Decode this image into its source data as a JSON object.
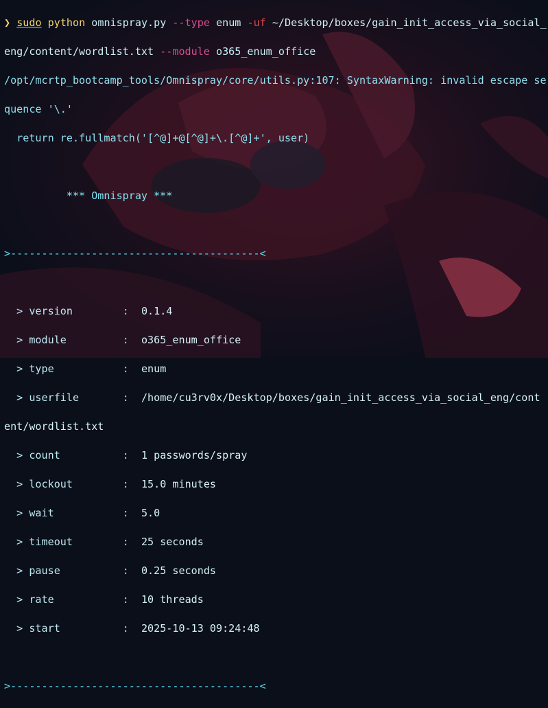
{
  "theme": {
    "background": "#0b0f1a",
    "accent": "#5cdaf3",
    "prompt": "#f5d46c",
    "flag": "#d84c8f"
  },
  "prompt": {
    "symbol": "❯",
    "sudo": "sudo",
    "python": "python",
    "script": "omnispray.py",
    "flag_type": "--type",
    "type_value": "enum",
    "flag_uf": "-uf",
    "uf_value_line1": "~/Desktop/boxes/gain_init_access_via_social_",
    "uf_value_line2": "eng/content/wordlist.txt",
    "flag_module": "--module",
    "module_value": "o365_enum_office"
  },
  "warning": {
    "line1": "/opt/mcrtp_bootcamp_tools/Omnispray/core/utils.py:107: SyntaxWarning: invalid escape se",
    "line2": "quence '\\.'",
    "line3": "  return re.fullmatch('[^@]+@[^@]+\\.[^@]+', user)"
  },
  "banner": "          *** Omnispray ***",
  "separator": ">----------------------------------------<",
  "config": [
    {
      "key": "  > version",
      "value": "0.1.4"
    },
    {
      "key": "  > module",
      "value": "o365_enum_office"
    },
    {
      "key": "  > type",
      "value": "enum"
    },
    {
      "key": "  > userfile",
      "value": "/home/cu3rv0x/Desktop/boxes/gain_init_access_via_social_eng/cont"
    },
    {
      "key": "  > count",
      "value": "1 passwords/spray"
    },
    {
      "key": "  > lockout",
      "value": "15.0 minutes"
    },
    {
      "key": "  > wait",
      "value": "5.0"
    },
    {
      "key": "  > timeout",
      "value": "25 seconds"
    },
    {
      "key": "  > pause",
      "value": "0.25 seconds"
    },
    {
      "key": "  > rate",
      "value": "10 threads"
    },
    {
      "key": "  > start",
      "value": "2025-10-13 09:24:48"
    }
  ],
  "userfile_wrap": "ent/wordlist.txt",
  "colon": ":"
}
